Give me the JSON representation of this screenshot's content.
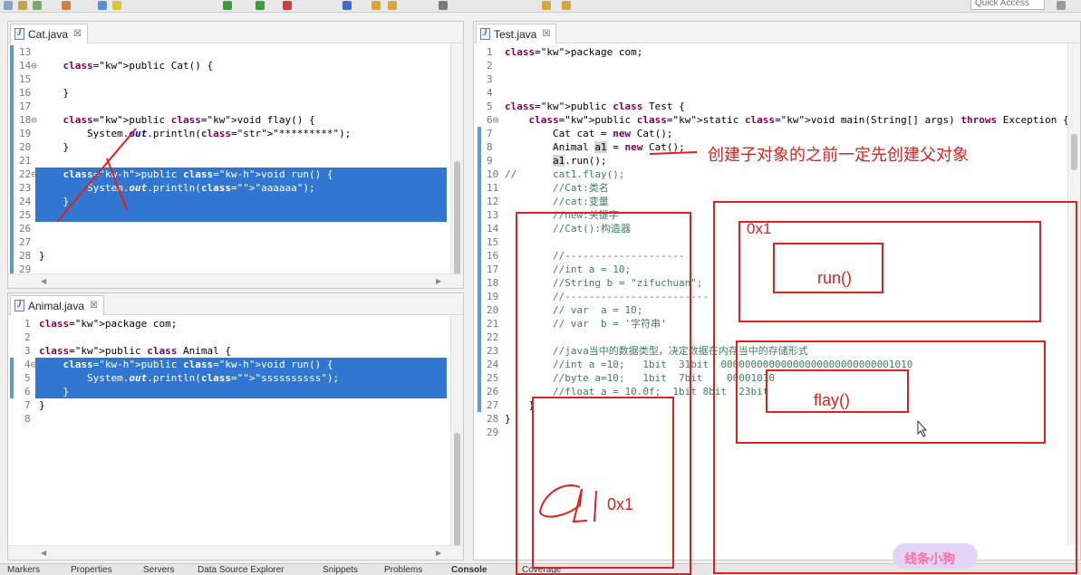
{
  "toolbar": {
    "quick_access": "Quick Access"
  },
  "cat_editor": {
    "tab_label": "Cat.java",
    "lines": [
      {
        "n": "13",
        "text": ""
      },
      {
        "n": "14⊖",
        "text": "    public Cat() {"
      },
      {
        "n": "15",
        "text": ""
      },
      {
        "n": "16",
        "text": "    }"
      },
      {
        "n": "17",
        "text": ""
      },
      {
        "n": "18⊖",
        "text": "    public void flay() {"
      },
      {
        "n": "19",
        "text": "        System.out.println(\"*********\");"
      },
      {
        "n": "20",
        "text": "    }"
      },
      {
        "n": "21",
        "text": ""
      },
      {
        "n": "22⊖",
        "text": "    public void run() {"
      },
      {
        "n": "23",
        "text": "        System.out.println(\"aaaaaa\");"
      },
      {
        "n": "24",
        "text": "    }"
      },
      {
        "n": "25",
        "text": ""
      },
      {
        "n": "26",
        "text": ""
      },
      {
        "n": "27",
        "text": ""
      },
      {
        "n": "28",
        "text": "}"
      },
      {
        "n": "29",
        "text": ""
      }
    ]
  },
  "animal_editor": {
    "tab_label": "Animal.java",
    "lines": [
      {
        "n": "1",
        "text": "package com;"
      },
      {
        "n": "2",
        "text": ""
      },
      {
        "n": "3",
        "text": "public class Animal {"
      },
      {
        "n": "4⊖",
        "text": "    public void run() {"
      },
      {
        "n": "5",
        "text": "        System.out.println(\"ssssssssss\");"
      },
      {
        "n": "6",
        "text": "    }"
      },
      {
        "n": "7",
        "text": "}"
      },
      {
        "n": "8",
        "text": ""
      }
    ]
  },
  "test_editor": {
    "tab_label": "Test.java",
    "lines": [
      {
        "n": "1",
        "text": "package com;"
      },
      {
        "n": "2",
        "text": ""
      },
      {
        "n": "3",
        "text": ""
      },
      {
        "n": "4",
        "text": ""
      },
      {
        "n": "5",
        "text": "public class Test {"
      },
      {
        "n": "6⊖",
        "text": "    public static void main(String[] args) throws Exception {"
      },
      {
        "n": "7",
        "text": "        Cat cat = new Cat();"
      },
      {
        "n": "8",
        "text": "        Animal a1 = new Cat();"
      },
      {
        "n": "9",
        "text": "        a1.run();"
      },
      {
        "n": "10",
        "text": "//      cat1.flay();"
      },
      {
        "n": "11",
        "text": "        //Cat:类名"
      },
      {
        "n": "12",
        "text": "        //cat:变量"
      },
      {
        "n": "13",
        "text": "        //new:关键字"
      },
      {
        "n": "14",
        "text": "        //Cat():构造器"
      },
      {
        "n": "15",
        "text": ""
      },
      {
        "n": "16",
        "text": "        //--------------------"
      },
      {
        "n": "17",
        "text": "        //int a = 10;"
      },
      {
        "n": "18",
        "text": "        //String b = \"zifuchuan\";"
      },
      {
        "n": "19",
        "text": "        //------------------------"
      },
      {
        "n": "20",
        "text": "        // var  a = 10;"
      },
      {
        "n": "21",
        "text": "        // var  b = '字符串'"
      },
      {
        "n": "22",
        "text": ""
      },
      {
        "n": "23",
        "text": "        //java当中的数据类型，决定数据在内存当中的存储形式"
      },
      {
        "n": "24",
        "text": "        //int a =10;   1bit  31bit  00000000000000000000000000001010"
      },
      {
        "n": "25",
        "text": "        //byte a=10;   1bit  7bit    00001010"
      },
      {
        "n": "26",
        "text": "        //float a = 10.0f;  1bit 8bit  23bit"
      },
      {
        "n": "27",
        "text": "    }"
      },
      {
        "n": "28",
        "text": "}"
      },
      {
        "n": "29",
        "text": ""
      }
    ]
  },
  "annotations": {
    "note": "创建子对象的之前一定先创建父对象",
    "addr_top": "0x1",
    "method_run": "run()",
    "method_flay": "flay()",
    "addr_bottom": "0x1"
  },
  "bottom_tabs": [
    "Markers",
    "Properties",
    "Servers",
    "Data Source Explorer",
    "Snippets",
    "Problems",
    "Console",
    "Coverage"
  ],
  "watermark": "线条小狗",
  "colors": {
    "selection": "#3176d1",
    "annotation": "#e0201c",
    "keyword": "#7f0055",
    "string": "#2a00ff",
    "comment": "#3f7f5f"
  }
}
